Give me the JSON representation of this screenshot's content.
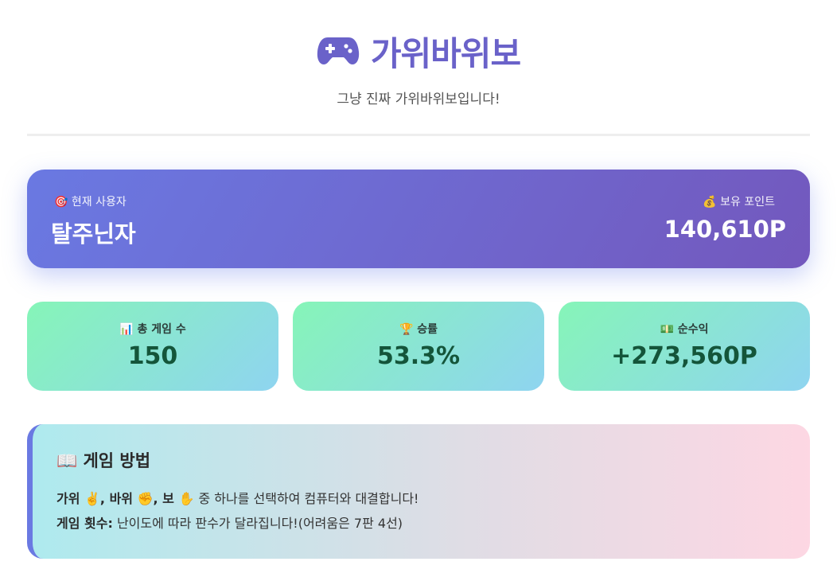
{
  "header": {
    "icon": "gamepad-icon",
    "title": "가위바위보",
    "subtitle": "그냥 진짜 가위바위보입니다!"
  },
  "user_card": {
    "user_label": "🎯 현재 사용자",
    "user_name": "탈주닌자",
    "points_label": "💰 보유 포인트",
    "points_value": "140,610P"
  },
  "stats": [
    {
      "label": "📊 총 게임 수",
      "value": "150"
    },
    {
      "label": "🏆 승률",
      "value": "53.3%"
    },
    {
      "label": "💵 순수익",
      "value": "+273,560P"
    }
  ],
  "howto": {
    "title": "📖 게임 방법",
    "line1_bold": "가위 ✌️, 바위 ✊, 보 ✋",
    "line1_rest": " 중 하나를 선택하여 컴퓨터와 대결합니다!",
    "line2_bold": "게임 횟수:",
    "line2_rest": " 난이도에 따라 판수가 달라집니다!(어려움은 7판 4선)"
  },
  "colors": {
    "accent": "#6a62c9",
    "card_gradient_start": "#6a79e2",
    "card_gradient_end": "#7358bd",
    "stat_gradient_start": "#86f5b8",
    "stat_gradient_end": "#8fd4f0"
  }
}
